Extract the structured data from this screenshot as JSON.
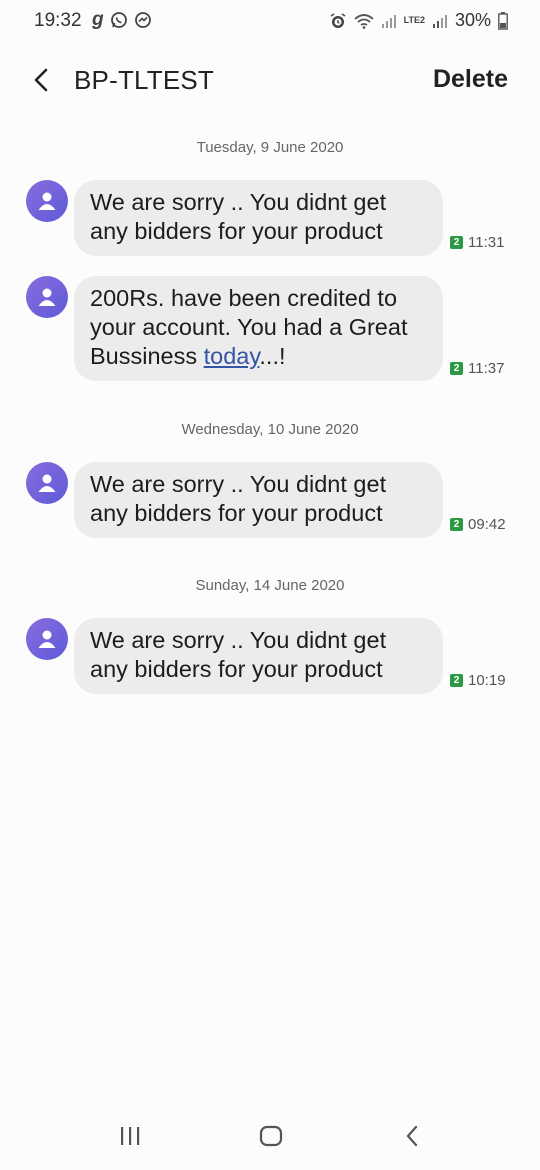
{
  "status": {
    "time": "19:32",
    "battery_pct": "30%",
    "network": "LTE2"
  },
  "header": {
    "title": "BP-TLTEST",
    "delete_label": "Delete"
  },
  "conversation": [
    {
      "date": "Tuesday, 9 June 2020",
      "messages": [
        {
          "text": "We are sorry .. You didnt get any bidders for your product",
          "sim": "2",
          "time": "11:31"
        },
        {
          "text_before": "200Rs. have been credited to your account. You had a Great Bussiness ",
          "link": "today",
          "text_after": "...!",
          "sim": "2",
          "time": "11:37"
        }
      ]
    },
    {
      "date": "Wednesday, 10 June 2020",
      "messages": [
        {
          "text": "We are sorry .. You didnt get any bidders for your product",
          "sim": "2",
          "time": "09:42"
        }
      ]
    },
    {
      "date": "Sunday, 14 June 2020",
      "messages": [
        {
          "text": "We are sorry .. You didnt get any bidders for your product",
          "sim": "2",
          "time": "10:19"
        }
      ]
    }
  ],
  "navbar": {
    "items": [
      "recent-apps-icon",
      "home-icon",
      "back-icon"
    ]
  },
  "colors": {
    "bubble": "#ececec",
    "avatar_from": "#8a6be0",
    "avatar_to": "#5d5bd6",
    "sim_badge": "#2c9a44",
    "link": "#3454a8"
  }
}
